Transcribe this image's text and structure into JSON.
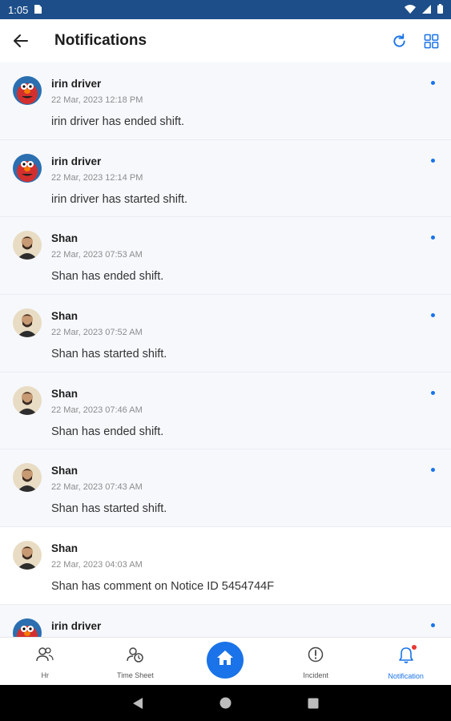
{
  "status_bar": {
    "time": "1:05"
  },
  "header": {
    "title": "Notifications",
    "back_icon": "arrow-left-icon",
    "actions": [
      "refresh-icon",
      "grid-icon"
    ]
  },
  "notifications": [
    {
      "name": "irin driver",
      "time": "22 Mar, 2023 12:18 PM",
      "message": "irin driver has ended shift.",
      "avatar": "elmo",
      "unread": true
    },
    {
      "name": "irin driver",
      "time": "22 Mar, 2023 12:14 PM",
      "message": "irin driver has started shift.",
      "avatar": "elmo",
      "unread": true
    },
    {
      "name": "Shan",
      "time": "22 Mar, 2023 07:53 AM",
      "message": "Shan has ended shift.",
      "avatar": "person",
      "unread": true
    },
    {
      "name": "Shan",
      "time": "22 Mar, 2023 07:52 AM",
      "message": "Shan has started shift.",
      "avatar": "person",
      "unread": true
    },
    {
      "name": "Shan",
      "time": "22 Mar, 2023 07:46 AM",
      "message": "Shan has ended shift.",
      "avatar": "person",
      "unread": true
    },
    {
      "name": "Shan",
      "time": "22 Mar, 2023 07:43 AM",
      "message": "Shan has started shift.",
      "avatar": "person",
      "unread": true
    },
    {
      "name": "Shan",
      "time": "22 Mar, 2023 04:03 AM",
      "message": "Shan has comment on Notice ID 5454744F",
      "avatar": "person",
      "unread": false
    },
    {
      "name": "irin driver",
      "time": "",
      "message": "",
      "avatar": "elmo",
      "unread": true
    }
  ],
  "bottom_nav": {
    "hr": "Hr",
    "timesheet": "Time Sheet",
    "incident": "Incident",
    "notification": "Notification"
  },
  "colors": {
    "accent": "#1a73e8",
    "status_bar": "#1d4e89",
    "unread_bg": "#f6f8fc"
  }
}
